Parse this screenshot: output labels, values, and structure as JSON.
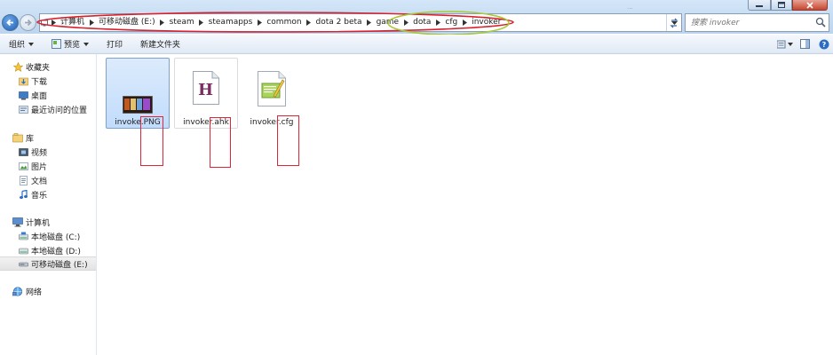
{
  "window": {
    "ghost_title_text": "..."
  },
  "address_bar": {
    "breadcrumbs": [
      "计算机",
      "可移动磁盘 (E:)",
      "steam",
      "steamapps",
      "common",
      "dota 2 beta",
      "game",
      "dota",
      "cfg",
      "invoker"
    ]
  },
  "search": {
    "placeholder": "搜索 invoker"
  },
  "toolbar": {
    "organize_label": "组织",
    "preview_label": "预览",
    "print_label": "打印",
    "new_folder_label": "新建文件夹"
  },
  "nav_pane": {
    "favorites": {
      "label": "收藏夹",
      "items": [
        {
          "label": "下载",
          "icon": "download-folder-icon"
        },
        {
          "label": "桌面",
          "icon": "desktop-icon"
        },
        {
          "label": "最近访问的位置",
          "icon": "recent-places-icon"
        }
      ]
    },
    "libraries": {
      "label": "库",
      "items": [
        {
          "label": "视频",
          "icon": "video-icon"
        },
        {
          "label": "图片",
          "icon": "pictures-icon"
        },
        {
          "label": "文档",
          "icon": "documents-icon"
        },
        {
          "label": "音乐",
          "icon": "music-icon"
        }
      ]
    },
    "computer": {
      "label": "计算机",
      "items": [
        {
          "label": "本地磁盘 (C:)",
          "icon": "drive-icon"
        },
        {
          "label": "本地磁盘 (D:)",
          "icon": "drive-icon"
        },
        {
          "label": "可移动磁盘 (E:)",
          "icon": "usb-drive-icon",
          "selected": true
        }
      ]
    },
    "network": {
      "label": "网络"
    }
  },
  "files": [
    {
      "name": "invoke.PNG",
      "type": "png-image",
      "selected": true
    },
    {
      "name": "invoker.ahk",
      "type": "autohotkey-script",
      "selected": false
    },
    {
      "name": "invoker.cfg",
      "type": "cfg-file",
      "selected": false
    }
  ],
  "colors": {
    "annotation_red": "#d8202e",
    "annotation_green": "#a8c93a",
    "selection_blue": "#c1dcfc"
  }
}
